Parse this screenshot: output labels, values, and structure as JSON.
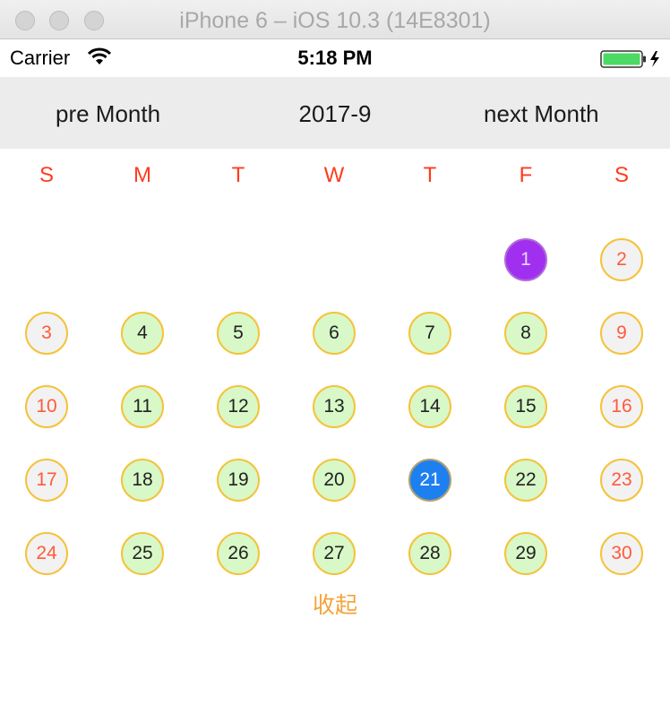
{
  "window": {
    "title": "iPhone 6 – iOS 10.3 (14E8301)"
  },
  "status_bar": {
    "carrier": "Carrier",
    "time": "5:18 PM"
  },
  "nav": {
    "prev_label": "pre Month",
    "current_month": "2017-9",
    "next_label": "next Month"
  },
  "weekdays": [
    "S",
    "M",
    "T",
    "W",
    "T",
    "F",
    "S"
  ],
  "days": [
    "1",
    "2",
    "3",
    "4",
    "5",
    "6",
    "7",
    "8",
    "9",
    "10",
    "11",
    "12",
    "13",
    "14",
    "15",
    "16",
    "17",
    "18",
    "19",
    "20",
    "21",
    "22",
    "23",
    "24",
    "25",
    "26",
    "27",
    "28",
    "29",
    "30"
  ],
  "first_weekday_index": 5,
  "highlighted": {
    "purple_day": "1",
    "selected_day": "21"
  },
  "collapse_label": "收起",
  "colors": {
    "weekday_text": "#ff3b1f",
    "weekday_cell_bg": "#d8f8c8",
    "weekend_cell_bg": "#f2f2f2",
    "cell_border": "#f5c23a",
    "purple": "#a12ff0",
    "selected_blue": "#1e80ef",
    "collapse_text": "#f5a33a"
  }
}
